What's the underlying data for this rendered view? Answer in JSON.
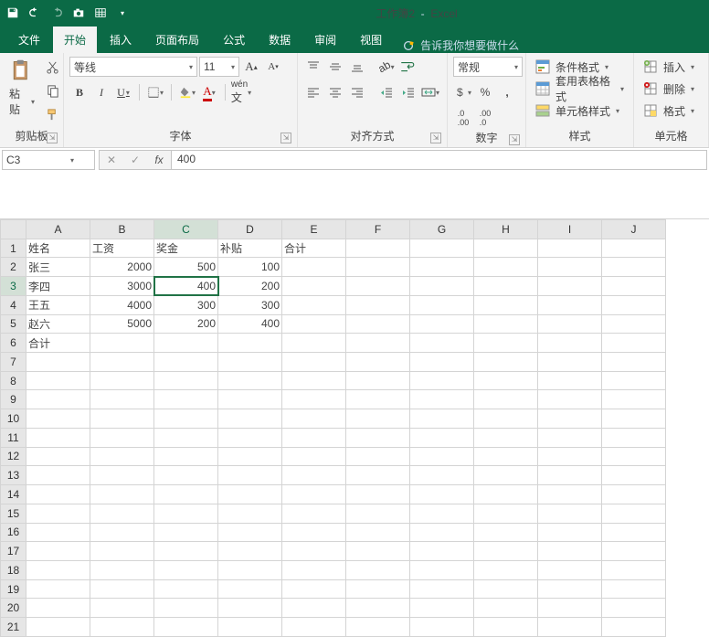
{
  "title": {
    "doc": "工作簿2",
    "app": "Excel"
  },
  "tabs": {
    "file": "文件",
    "home": "开始",
    "insert": "插入",
    "layout": "页面布局",
    "formula": "公式",
    "data": "数据",
    "review": "审阅",
    "view": "视图",
    "tell": "告诉我你想要做什么"
  },
  "ribbon": {
    "clipboard": {
      "paste": "粘贴",
      "label": "剪贴板"
    },
    "font": {
      "name": "等线",
      "size": "11",
      "label": "字体"
    },
    "align": {
      "label": "对齐方式"
    },
    "number": {
      "format": "常规",
      "label": "数字"
    },
    "styles": {
      "cond": "条件格式",
      "tbl": "套用表格格式",
      "cell": "单元格样式",
      "label": "样式"
    },
    "cells": {
      "ins": "插入",
      "del": "删除",
      "fmt": "格式",
      "label": "单元格"
    }
  },
  "namebox": "C3",
  "formula": "400",
  "cols": [
    "A",
    "B",
    "C",
    "D",
    "E",
    "F",
    "G",
    "H",
    "I",
    "J"
  ],
  "rows": 21,
  "selected": {
    "row": 3,
    "col": "C"
  },
  "data": {
    "1": {
      "A": "姓名",
      "B": "工资",
      "C": "奖金",
      "D": "补贴",
      "E": "合计"
    },
    "2": {
      "A": "张三",
      "B": "2000",
      "C": "500",
      "D": "100"
    },
    "3": {
      "A": "李四",
      "B": "3000",
      "C": "400",
      "D": "200"
    },
    "4": {
      "A": "王五",
      "B": "4000",
      "C": "300",
      "D": "300"
    },
    "5": {
      "A": "赵六",
      "B": "5000",
      "C": "200",
      "D": "400"
    },
    "6": {
      "A": "合计"
    }
  }
}
